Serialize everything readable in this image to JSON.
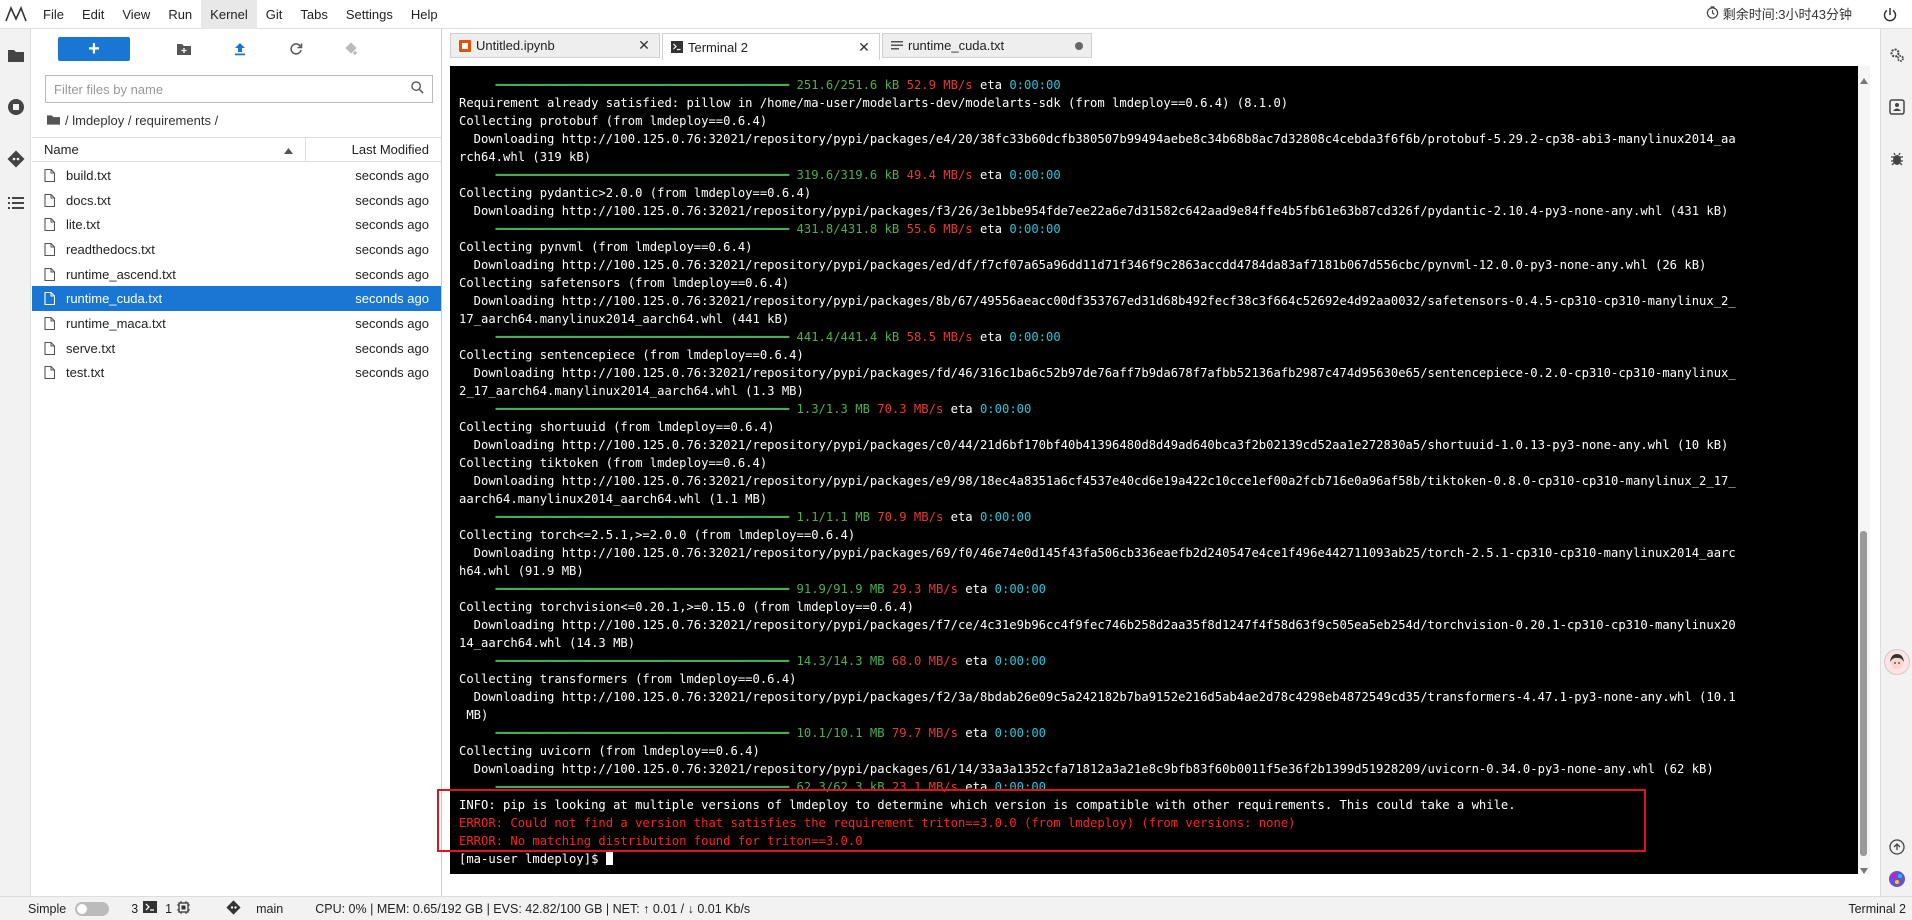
{
  "menubar": {
    "items": [
      "File",
      "Edit",
      "View",
      "Run",
      "Kernel",
      "Git",
      "Tabs",
      "Settings",
      "Help"
    ],
    "active_index": 4,
    "timer_label": "剩余时间:3小时43分钟"
  },
  "filebrowser": {
    "filter_placeholder": "Filter files by name",
    "breadcrumb": "/ lmdeploy / requirements /",
    "header_name": "Name",
    "header_modified": "Last Modified",
    "files": [
      {
        "name": "build.txt",
        "modified": "seconds ago",
        "selected": false
      },
      {
        "name": "docs.txt",
        "modified": "seconds ago",
        "selected": false
      },
      {
        "name": "lite.txt",
        "modified": "seconds ago",
        "selected": false
      },
      {
        "name": "readthedocs.txt",
        "modified": "seconds ago",
        "selected": false
      },
      {
        "name": "runtime_ascend.txt",
        "modified": "seconds ago",
        "selected": false
      },
      {
        "name": "runtime_cuda.txt",
        "modified": "seconds ago",
        "selected": true
      },
      {
        "name": "runtime_maca.txt",
        "modified": "seconds ago",
        "selected": false
      },
      {
        "name": "serve.txt",
        "modified": "seconds ago",
        "selected": false
      },
      {
        "name": "test.txt",
        "modified": "seconds ago",
        "selected": false
      }
    ]
  },
  "tabs": [
    {
      "label": "Untitled.ipynb",
      "icon": "notebook-icon",
      "active": false,
      "state": "close"
    },
    {
      "label": "Terminal 2",
      "icon": "terminal-icon",
      "active": true,
      "state": "close"
    },
    {
      "label": "runtime_cuda.txt",
      "icon": "text-file-icon",
      "active": false,
      "state": "unsaved"
    }
  ],
  "terminal": {
    "lines": [
      [
        {
          "t": "     ━━━━━━━━━━━━━━━━━━━━━━━━━━━━━━━━━━━━━━━━ ",
          "c": "bar"
        },
        {
          "t": "251.6/251.6 kB",
          "c": "g"
        },
        {
          "t": " 52.9 MB/s",
          "c": "r"
        },
        {
          "t": " eta ",
          "c": ""
        },
        {
          "t": "0:00:00",
          "c": "c"
        }
      ],
      [
        {
          "t": "Requirement already satisfied: pillow in /home/ma-user/modelarts-dev/modelarts-sdk (from lmdeploy==0.6.4) (8.1.0)",
          "c": ""
        }
      ],
      [
        {
          "t": "Collecting protobuf (from lmdeploy==0.6.4)",
          "c": ""
        }
      ],
      [
        {
          "t": "  Downloading http://100.125.0.76:32021/repository/pypi/packages/e4/20/38fc33b60dcfb380507b99494aebe8c34b68b8ac7d32808c4cebda3f6f6b/protobuf-5.29.2-cp38-abi3-manylinux2014_aa",
          "c": ""
        }
      ],
      [
        {
          "t": "rch64.whl (319 kB)",
          "c": ""
        }
      ],
      [
        {
          "t": "     ━━━━━━━━━━━━━━━━━━━━━━━━━━━━━━━━━━━━━━━━ ",
          "c": "bar"
        },
        {
          "t": "319.6/319.6 kB",
          "c": "g"
        },
        {
          "t": " 49.4 MB/s",
          "c": "r"
        },
        {
          "t": " eta ",
          "c": ""
        },
        {
          "t": "0:00:00",
          "c": "c"
        }
      ],
      [
        {
          "t": "Collecting pydantic>2.0.0 (from lmdeploy==0.6.4)",
          "c": ""
        }
      ],
      [
        {
          "t": "  Downloading http://100.125.0.76:32021/repository/pypi/packages/f3/26/3e1bbe954fde7ee22a6e7d31582c642aad9e84ffe4b5fb61e63b87cd326f/pydantic-2.10.4-py3-none-any.whl (431 kB)",
          "c": ""
        }
      ],
      [
        {
          "t": "     ━━━━━━━━━━━━━━━━━━━━━━━━━━━━━━━━━━━━━━━━ ",
          "c": "bar"
        },
        {
          "t": "431.8/431.8 kB",
          "c": "g"
        },
        {
          "t": " 55.6 MB/s",
          "c": "r"
        },
        {
          "t": " eta ",
          "c": ""
        },
        {
          "t": "0:00:00",
          "c": "c"
        }
      ],
      [
        {
          "t": "Collecting pynvml (from lmdeploy==0.6.4)",
          "c": ""
        }
      ],
      [
        {
          "t": "  Downloading http://100.125.0.76:32021/repository/pypi/packages/ed/df/f7cf07a65a96dd11d71f346f9c2863accdd4784da83af7181b067d556cbc/pynvml-12.0.0-py3-none-any.whl (26 kB)",
          "c": ""
        }
      ],
      [
        {
          "t": "Collecting safetensors (from lmdeploy==0.6.4)",
          "c": ""
        }
      ],
      [
        {
          "t": "  Downloading http://100.125.0.76:32021/repository/pypi/packages/8b/67/49556aeacc00df353767ed31d68b492fecf38c3f664c52692e4d92aa0032/safetensors-0.4.5-cp310-cp310-manylinux_2_",
          "c": ""
        }
      ],
      [
        {
          "t": "17_aarch64.manylinux2014_aarch64.whl (441 kB)",
          "c": ""
        }
      ],
      [
        {
          "t": "     ━━━━━━━━━━━━━━━━━━━━━━━━━━━━━━━━━━━━━━━━ ",
          "c": "bar"
        },
        {
          "t": "441.4/441.4 kB",
          "c": "g"
        },
        {
          "t": " 58.5 MB/s",
          "c": "r"
        },
        {
          "t": " eta ",
          "c": ""
        },
        {
          "t": "0:00:00",
          "c": "c"
        }
      ],
      [
        {
          "t": "Collecting sentencepiece (from lmdeploy==0.6.4)",
          "c": ""
        }
      ],
      [
        {
          "t": "  Downloading http://100.125.0.76:32021/repository/pypi/packages/fd/46/316c1ba6c52b97de76aff7b9da678f7afbb52136afb2987c474d95630e65/sentencepiece-0.2.0-cp310-cp310-manylinux_",
          "c": ""
        }
      ],
      [
        {
          "t": "2_17_aarch64.manylinux2014_aarch64.whl (1.3 MB)",
          "c": ""
        }
      ],
      [
        {
          "t": "     ━━━━━━━━━━━━━━━━━━━━━━━━━━━━━━━━━━━━━━━━ ",
          "c": "bar"
        },
        {
          "t": "1.3/1.3 MB",
          "c": "g"
        },
        {
          "t": " 70.3 MB/s",
          "c": "r"
        },
        {
          "t": " eta ",
          "c": ""
        },
        {
          "t": "0:00:00",
          "c": "c"
        }
      ],
      [
        {
          "t": "Collecting shortuuid (from lmdeploy==0.6.4)",
          "c": ""
        }
      ],
      [
        {
          "t": "  Downloading http://100.125.0.76:32021/repository/pypi/packages/c0/44/21d6bf170bf40b41396480d8d49ad640bca3f2b02139cd52aa1e272830a5/shortuuid-1.0.13-py3-none-any.whl (10 kB)",
          "c": ""
        }
      ],
      [
        {
          "t": "Collecting tiktoken (from lmdeploy==0.6.4)",
          "c": ""
        }
      ],
      [
        {
          "t": "  Downloading http://100.125.0.76:32021/repository/pypi/packages/e9/98/18ec4a8351a6cf4537e40cd6e19a422c10cce1ef00a2fcb716e0a96af58b/tiktoken-0.8.0-cp310-cp310-manylinux_2_17_",
          "c": ""
        }
      ],
      [
        {
          "t": "aarch64.manylinux2014_aarch64.whl (1.1 MB)",
          "c": ""
        }
      ],
      [
        {
          "t": "     ━━━━━━━━━━━━━━━━━━━━━━━━━━━━━━━━━━━━━━━━ ",
          "c": "bar"
        },
        {
          "t": "1.1/1.1 MB",
          "c": "g"
        },
        {
          "t": " 70.9 MB/s",
          "c": "r"
        },
        {
          "t": " eta ",
          "c": ""
        },
        {
          "t": "0:00:00",
          "c": "c"
        }
      ],
      [
        {
          "t": "Collecting torch<=2.5.1,>=2.0.0 (from lmdeploy==0.6.4)",
          "c": ""
        }
      ],
      [
        {
          "t": "  Downloading http://100.125.0.76:32021/repository/pypi/packages/69/f0/46e74e0d145f43fa506cb336eaefb2d240547e4ce1f496e442711093ab25/torch-2.5.1-cp310-cp310-manylinux2014_aarc",
          "c": ""
        }
      ],
      [
        {
          "t": "h64.whl (91.9 MB)",
          "c": ""
        }
      ],
      [
        {
          "t": "     ━━━━━━━━━━━━━━━━━━━━━━━━━━━━━━━━━━━━━━━━ ",
          "c": "bar"
        },
        {
          "t": "91.9/91.9 MB",
          "c": "g"
        },
        {
          "t": " 29.3 MB/s",
          "c": "r"
        },
        {
          "t": " eta ",
          "c": ""
        },
        {
          "t": "0:00:00",
          "c": "c"
        }
      ],
      [
        {
          "t": "Collecting torchvision<=0.20.1,>=0.15.0 (from lmdeploy==0.6.4)",
          "c": ""
        }
      ],
      [
        {
          "t": "  Downloading http://100.125.0.76:32021/repository/pypi/packages/f7/ce/4c31e9b96cc4f9fec746b258d2aa35f8d1247f4f58d63f9c505ea5eb254d/torchvision-0.20.1-cp310-cp310-manylinux20",
          "c": ""
        }
      ],
      [
        {
          "t": "14_aarch64.whl (14.3 MB)",
          "c": ""
        }
      ],
      [
        {
          "t": "     ━━━━━━━━━━━━━━━━━━━━━━━━━━━━━━━━━━━━━━━━ ",
          "c": "bar"
        },
        {
          "t": "14.3/14.3 MB",
          "c": "g"
        },
        {
          "t": " 68.0 MB/s",
          "c": "r"
        },
        {
          "t": " eta ",
          "c": ""
        },
        {
          "t": "0:00:00",
          "c": "c"
        }
      ],
      [
        {
          "t": "Collecting transformers (from lmdeploy==0.6.4)",
          "c": ""
        }
      ],
      [
        {
          "t": "  Downloading http://100.125.0.76:32021/repository/pypi/packages/f2/3a/8bdab26e09c5a242182b7ba9152e216d5ab4ae2d78c4298eb4872549cd35/transformers-4.47.1-py3-none-any.whl (10.1",
          "c": ""
        }
      ],
      [
        {
          "t": " MB)",
          "c": ""
        }
      ],
      [
        {
          "t": "     ━━━━━━━━━━━━━━━━━━━━━━━━━━━━━━━━━━━━━━━━ ",
          "c": "bar"
        },
        {
          "t": "10.1/10.1 MB",
          "c": "g"
        },
        {
          "t": " 79.7 MB/s",
          "c": "r"
        },
        {
          "t": " eta ",
          "c": ""
        },
        {
          "t": "0:00:00",
          "c": "c"
        }
      ],
      [
        {
          "t": "Collecting uvicorn (from lmdeploy==0.6.4)",
          "c": ""
        }
      ],
      [
        {
          "t": "  Downloading http://100.125.0.76:32021/repository/pypi/packages/61/14/33a3a1352cfa71812a3a21e8c9bfb83f60b0011f5e36f2b1399d51928209/uvicorn-0.34.0-py3-none-any.whl (62 kB)",
          "c": ""
        }
      ],
      [
        {
          "t": "     ━━━━━━━━━━━━━━━━━━━━━━━━━━━━━━━━━━━━━━━━ ",
          "c": "bar"
        },
        {
          "t": "62.3/62.3 kB",
          "c": "g"
        },
        {
          "t": " 23.1 MB/s",
          "c": "r"
        },
        {
          "t": " eta ",
          "c": ""
        },
        {
          "t": "0:00:00",
          "c": "c"
        }
      ],
      [
        {
          "t": "INFO: pip is looking at multiple versions of lmdeploy to determine which version is compatible with other requirements. This could take a while.",
          "c": ""
        }
      ],
      [
        {
          "t": "ERROR: Could not find a version that satisfies the requirement triton==3.0.0 (from lmdeploy) (from versions: none)",
          "c": "e"
        }
      ],
      [
        {
          "t": "ERROR: No matching distribution found for triton==3.0.0",
          "c": "e"
        }
      ],
      [
        {
          "t": "[ma-user lmdeploy]$ ",
          "c": ""
        }
      ]
    ]
  },
  "statusbar": {
    "mode_label": "Simple",
    "kernels_count": "3",
    "terminals_count": "1",
    "branch": "main",
    "resources": "CPU: 0% | MEM: 0.65/192 GB | EVS: 42.82/100 GB | NET: ↑ 0.01 / ↓ 0.01 Kb/s",
    "right_label": "Terminal 2"
  },
  "colors": {
    "accent": "#1976d2",
    "error_box": "#e0141b",
    "terminal_bg": "#000000"
  }
}
